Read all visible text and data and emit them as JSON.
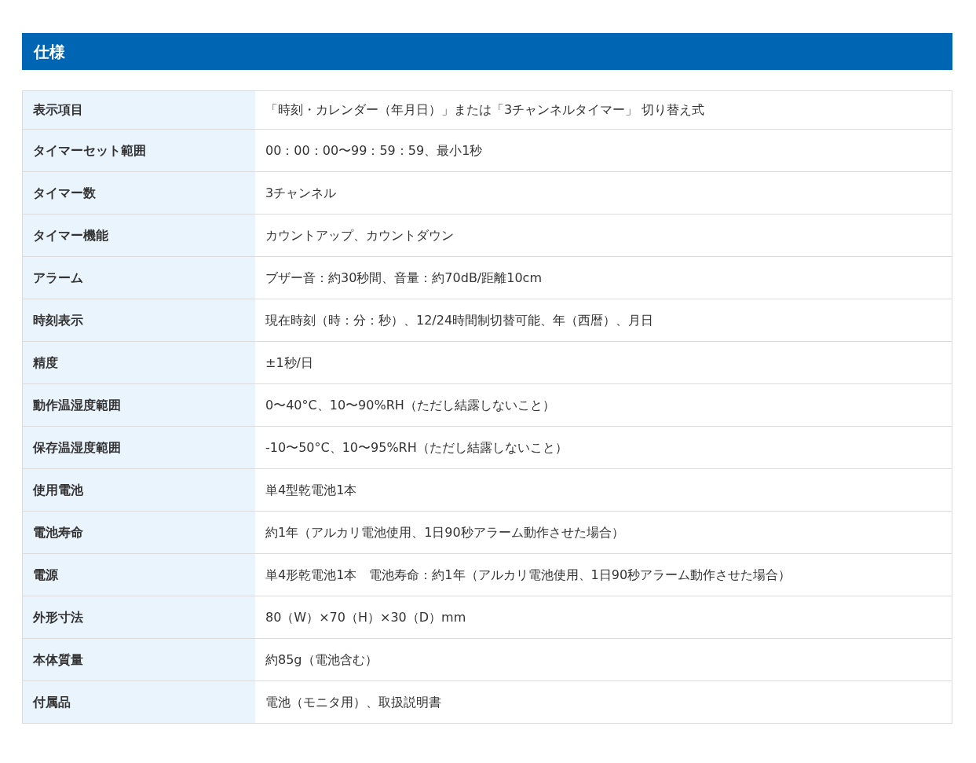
{
  "section": {
    "title": "仕様"
  },
  "table": {
    "rows": [
      {
        "label": "表示項目",
        "value": "「時刻・カレンダー（年月日）」または「3チャンネルタイマー」 切り替え式"
      },
      {
        "label": "タイマーセット範囲",
        "value": "00：00：00〜99：59：59、最小1秒"
      },
      {
        "label": "タイマー数",
        "value": "3チャンネル"
      },
      {
        "label": "タイマー機能",
        "value": "カウントアップ、カウントダウン"
      },
      {
        "label": "アラーム",
        "value": "ブザー音：約30秒間、音量：約70dB/距離10cm"
      },
      {
        "label": "時刻表示",
        "value": "現在時刻（時：分：秒）、12/24時間制切替可能、年（西暦）、月日"
      },
      {
        "label": "精度",
        "value": "±1秒/日"
      },
      {
        "label": "動作温湿度範囲",
        "value": "0〜40°C、10〜90%RH（ただし結露しないこと）"
      },
      {
        "label": "保存温湿度範囲",
        "value": "-10〜50°C、10〜95%RH（ただし結露しないこと）"
      },
      {
        "label": "使用電池",
        "value": "単4型乾電池1本"
      },
      {
        "label": "電池寿命",
        "value": "約1年（アルカリ電池使用、1日90秒アラーム動作させた場合）"
      },
      {
        "label": "電源",
        "value": "単4形乾電池1本　電池寿命：約1年（アルカリ電池使用、1日90秒アラーム動作させた場合）"
      },
      {
        "label": "外形寸法",
        "value": "80（W）×70（H）×30（D）mm"
      },
      {
        "label": "本体質量",
        "value": "約85g（電池含む）"
      },
      {
        "label": "付属品",
        "value": "電池（モニタ用）、取扱説明書"
      }
    ]
  }
}
